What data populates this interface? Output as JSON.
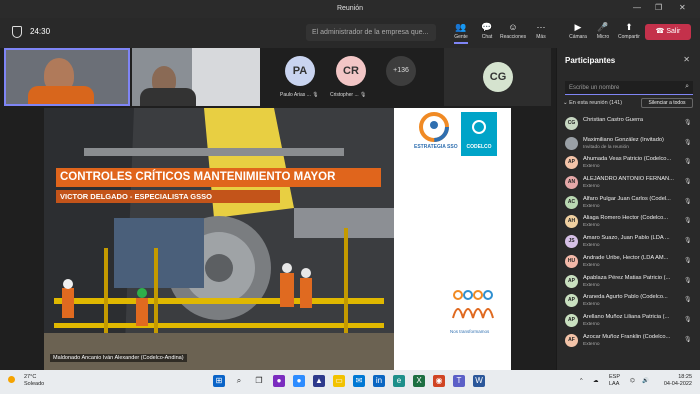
{
  "window": {
    "title": "Reunión"
  },
  "toolbar": {
    "timer": "24:30",
    "notice": "El administrador de la empresa que...",
    "buttons": [
      {
        "label": "Gente",
        "icon": "people-icon"
      },
      {
        "label": "Chat",
        "icon": "chat-icon"
      },
      {
        "label": "Reacciones",
        "icon": "reactions-icon"
      },
      {
        "label": "Más",
        "icon": "more-icon"
      },
      {
        "label": "Cámara",
        "icon": "camera-off-icon"
      },
      {
        "label": "Micro",
        "icon": "mic-off-icon"
      },
      {
        "label": "Compartir",
        "icon": "share-icon"
      }
    ],
    "leave_label": "Salir"
  },
  "video_strip": {
    "tiles": [
      {
        "initials": "PA",
        "name": "Paulo Arias ..."
      },
      {
        "initials": "CR",
        "name": "Cristopher ..."
      },
      {
        "initials": "CG"
      }
    ],
    "overflow": "+136"
  },
  "stage": {
    "title": "CONTROLES CRÍTICOS MANTENIMIENTO MAYOR",
    "subtitle": "VICTOR DELGADO - ESPECIALISTA GSSO",
    "logo1": "ESTRATEGIA SSO",
    "logo2": "CODELCO",
    "logo3": "Nos transformamos",
    "presenter": "Maldonado Ancanio Iván Alexander (Codelco-Andina)"
  },
  "participants": {
    "title": "Participantes",
    "search_placeholder": "Escribe un nombre",
    "in_meeting": "En esta reunión (141)",
    "mute_all": "Silenciar a todos",
    "people": [
      {
        "initials": "CG",
        "name": "Christian Castro Guerra",
        "status": "",
        "color": "#c7d7c2"
      },
      {
        "initials": "",
        "name": "Maximiliano González (Invitado)",
        "status": "Invitado de la reunión",
        "color": "#9aa0a6"
      },
      {
        "initials": "AP",
        "name": "Ahumada Veas Patricio (Codelco...",
        "status": "Externo",
        "color": "#f3c3a8"
      },
      {
        "initials": "AN",
        "name": "ALEJANDRO ANTONIO FERNAN...",
        "status": "Externo",
        "color": "#e5a8a8"
      },
      {
        "initials": "AC",
        "name": "Alfaro Pulgar Juan Carlos (Codel...",
        "status": "Externo",
        "color": "#b9d8b2"
      },
      {
        "initials": "AH",
        "name": "Aliaga Romero Hector (Codelco...",
        "status": "Externo",
        "color": "#f0d0a0"
      },
      {
        "initials": "JS",
        "name": "Amaro Suazo, Juan Pablo (LDA ...",
        "status": "Externo",
        "color": "#d6c0e6"
      },
      {
        "initials": "HU",
        "name": "Andrade Uribe, Hector (LDA AM...",
        "status": "Externo",
        "color": "#f4b9a9"
      },
      {
        "initials": "AP",
        "name": "Apablaza Pérez Matias Patricio (...",
        "status": "Externo",
        "color": "#c9e0c0"
      },
      {
        "initials": "AP",
        "name": "Araneda Agurto Pablo (Codelco...",
        "status": "Externo",
        "color": "#c9e0c0"
      },
      {
        "initials": "AP",
        "name": "Arellano Muñoz Liliana Patricia (...",
        "status": "Externo",
        "color": "#c9e0c0"
      },
      {
        "initials": "AF",
        "name": "Azocar Muñoz Franklin (Codelco...",
        "status": "Externo",
        "color": "#f3c3a8"
      }
    ]
  },
  "taskbar": {
    "weather_temp": "27°C",
    "weather_desc": "Soleado",
    "lang": "ESP",
    "lang2": "LAA",
    "time": "18:25",
    "date": "04-04-2022"
  }
}
